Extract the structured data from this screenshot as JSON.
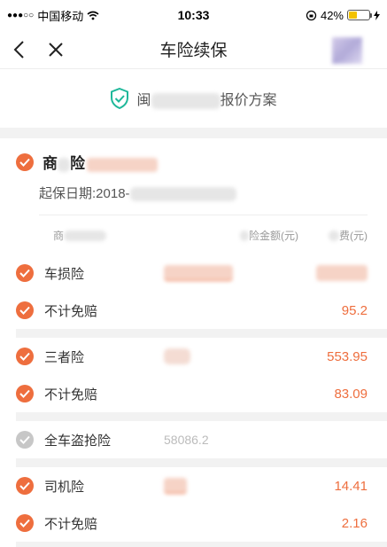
{
  "status_bar": {
    "carrier": "中国移动",
    "time": "10:33",
    "battery": "42%",
    "battery_level": 0.42
  },
  "nav": {
    "title": "车险续保",
    "back_icon": "chevron-left-icon",
    "close_icon": "close-icon"
  },
  "plan": {
    "prefix": "闽",
    "suffix": "报价方案"
  },
  "commercial": {
    "title_a": "商",
    "title_b": "险",
    "start_date_prefix": "起保日期:2018-",
    "columns": {
      "c1": "商",
      "c2": "险金额(元)",
      "c3": "费(元)"
    },
    "groups": [
      {
        "items": [
          {
            "name": "车损险",
            "amount": "",
            "premium": "",
            "checked": true
          },
          {
            "name": "不计免赔",
            "amount": "",
            "premium": "95.2",
            "checked": true
          }
        ]
      },
      {
        "items": [
          {
            "name": "三者险",
            "amount": "",
            "premium": "553.95",
            "checked": true
          },
          {
            "name": "不计免赔",
            "amount": "",
            "premium": "83.09",
            "checked": true
          }
        ]
      },
      {
        "items": [
          {
            "name": "全车盗抢险",
            "amount": "58086.2",
            "premium": "",
            "checked": false
          }
        ]
      },
      {
        "items": [
          {
            "name": "司机险",
            "amount": "",
            "premium": "14.41",
            "checked": true
          },
          {
            "name": "不计免赔",
            "amount": "",
            "premium": "2.16",
            "checked": true
          }
        ]
      }
    ]
  },
  "colors": {
    "accent": "#ee6e3e",
    "shield": "#1fb89a",
    "disabled": "#c7c7c7"
  }
}
